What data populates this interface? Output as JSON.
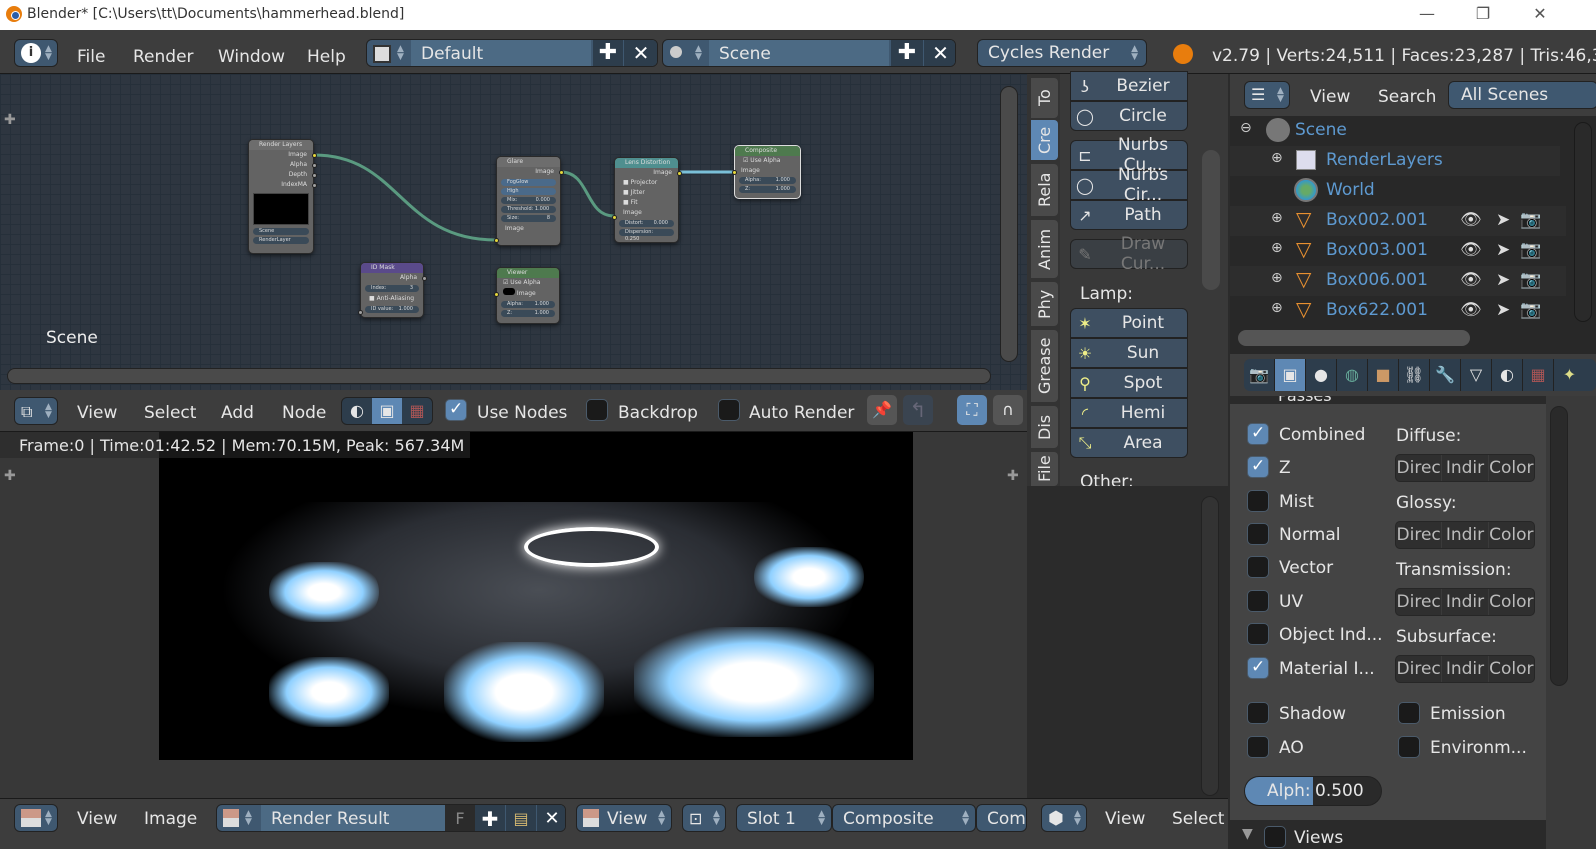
{
  "window": {
    "title": "Blender* [C:\\Users\\tt\\Documents\\hammerhead.blend]",
    "controls": [
      "minimize",
      "restore",
      "close"
    ]
  },
  "topbar": {
    "menus": [
      "File",
      "Render",
      "Window",
      "Help"
    ],
    "layout": "Default",
    "scene": "Scene",
    "engine": "Cycles Render",
    "stats": "v2.79 | Verts:24,511 | Faces:23,287 | Tris:46,3"
  },
  "node_editor": {
    "scene_label": "Scene",
    "nodes": {
      "render_layers": {
        "title": "Render Layers",
        "outputs": [
          "Image",
          "Alpha",
          "Depth",
          "IndexMA"
        ],
        "scene": "Scene",
        "layer": "RenderLayer"
      },
      "glare": {
        "title": "Glare",
        "output": "Image",
        "type": "FogGlow",
        "quality": "High",
        "mix": "Mix:",
        "mix_val": "0.000",
        "threshold": "Threshold: 1.000",
        "size": "Size:",
        "size_val": "8",
        "input": "Image"
      },
      "lens_distortion": {
        "title": "Lens Distortion",
        "output": "Image",
        "opts": [
          "Projector",
          "Jitter",
          "Fit"
        ],
        "input": "Image",
        "distort": "Distort:",
        "distort_val": "0.000",
        "dispersion": "Dispersion: 0.250"
      },
      "composite": {
        "title": "Composite",
        "use_alpha": "Use Alpha",
        "input": "Image",
        "alpha": "Alpha:",
        "alpha_val": "1.000",
        "z": "Z:",
        "z_val": "1.000"
      },
      "id_mask": {
        "title": "ID Mask",
        "output": "Alpha",
        "index": "Index:",
        "index_val": "3",
        "aa": "Anti-Aliasing",
        "idvalue": "ID value:",
        "idvalue_val": "1.000"
      },
      "viewer": {
        "title": "Viewer",
        "use_alpha": "Use Alpha",
        "input": "Image",
        "alpha": "Alpha:",
        "alpha_val": "1.000",
        "z": "Z:",
        "z_val": "1.000"
      }
    },
    "header": {
      "menus": [
        "View",
        "Select",
        "Add",
        "Node"
      ],
      "use_nodes": "Use Nodes",
      "use_nodes_checked": true,
      "backdrop": "Backdrop",
      "backdrop_checked": false,
      "auto_render": "Auto Render",
      "auto_render_checked": false
    }
  },
  "image_viewer": {
    "render_info": "Frame:0 | Time:01:42.52 | Mem:70.15M, Peak: 567.34M",
    "header": {
      "menus": [
        "View",
        "Image"
      ],
      "image": "Render Result",
      "fake_user": "F",
      "view": "View",
      "slot": "Slot 1",
      "pass": "Composite",
      "extra": "Com"
    }
  },
  "tool_shelf": {
    "tabs": [
      "To",
      "Cre",
      "Rela",
      "Anim",
      "Phy",
      "Grease",
      "Dis",
      "File"
    ],
    "active_tab": "Cre",
    "curve_buttons": [
      "Bezier",
      "Circle"
    ],
    "nurbs_buttons": [
      "Nurbs Cu...",
      "Nurbs Cir...",
      "Path"
    ],
    "draw_curve": "Draw Cur...",
    "lamp_label": "Lamp:",
    "lamps": [
      "Point",
      "Sun",
      "Spot",
      "Hemi",
      "Area"
    ],
    "other_label": "Other:"
  },
  "view3d_header": {
    "menus": [
      "View",
      "Select"
    ]
  },
  "outliner": {
    "header": {
      "menus": [
        "View",
        "Search"
      ],
      "display": "All Scenes"
    },
    "rows": [
      {
        "name": "Scene",
        "type": "scene"
      },
      {
        "name": "RenderLayers",
        "type": "renderlayers"
      },
      {
        "name": "World",
        "type": "world"
      },
      {
        "name": "Box002.001",
        "type": "mesh"
      },
      {
        "name": "Box003.001",
        "type": "mesh"
      },
      {
        "name": "Box006.001",
        "type": "mesh"
      },
      {
        "name": "Box622.001",
        "type": "mesh"
      }
    ]
  },
  "properties": {
    "tabs": [
      "render",
      "render-layers",
      "scene",
      "world",
      "object",
      "constraints",
      "modifiers",
      "data",
      "material",
      "texture",
      "particles"
    ],
    "active_tab": "render-layers",
    "section": "Passes",
    "passes": [
      {
        "label": "Combined",
        "checked": true
      },
      {
        "label": "Z",
        "checked": true
      },
      {
        "label": "Mist",
        "checked": false
      },
      {
        "label": "Normal",
        "checked": false
      },
      {
        "label": "Vector",
        "checked": false
      },
      {
        "label": "UV",
        "checked": false
      },
      {
        "label": "Object Ind...",
        "checked": false
      },
      {
        "label": "Material I...",
        "checked": true
      }
    ],
    "light_groups": [
      "Diffuse:",
      "Glossy:",
      "Transmission:",
      "Subsurface:"
    ],
    "light_buttons": [
      "Direc",
      "Indir",
      "Color"
    ],
    "extra": [
      {
        "label": "Shadow",
        "checked": false
      },
      {
        "label": "Emission",
        "checked": false
      },
      {
        "label": "AO",
        "checked": false
      },
      {
        "label": "Environm...",
        "checked": false
      }
    ],
    "alpha_label": "Alph:",
    "alpha_value": "0.500",
    "alpha_fraction": 0.5,
    "next_section": "Views"
  },
  "colors": {
    "accent": "#5e88b4",
    "outliner_text": "#5e9ad1",
    "node_bg": "#2e3640",
    "link": "#5a9a80"
  }
}
